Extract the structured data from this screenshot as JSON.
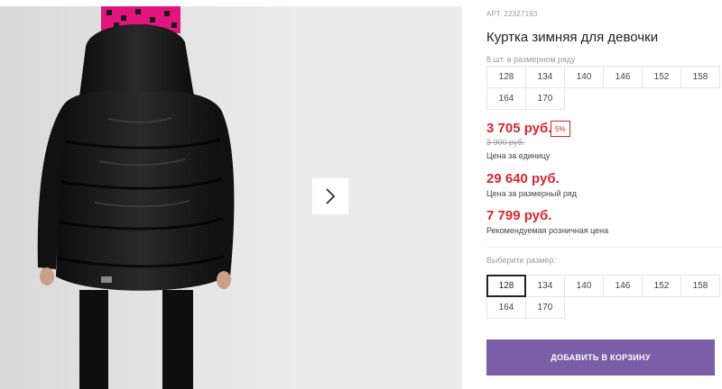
{
  "product": {
    "sku_label": "АРТ.",
    "sku": "22327193",
    "title": "Куртка зимняя для девочки"
  },
  "pack": {
    "label": "8 шт. в размерном ряду",
    "sizes": [
      "128",
      "134",
      "140",
      "146",
      "152",
      "158",
      "164",
      "170"
    ]
  },
  "prices": {
    "unit_price": "3 705 руб.",
    "discount": "5%",
    "old_price": "3 900 руб.",
    "unit_caption": "Цена за единицу",
    "pack_price": "29 640 руб.",
    "pack_caption": "Цена за размерный ряд",
    "rrp_price": "7 799 руб.",
    "rrp_caption": "Рекомендуемая розничная цена"
  },
  "size_select": {
    "label": "Выберите размер:",
    "sizes": [
      "128",
      "134",
      "140",
      "146",
      "152",
      "158",
      "164",
      "170"
    ],
    "selected": "128"
  },
  "actions": {
    "add_to_cart": "ДОБАВИТЬ В КОРЗИНУ"
  },
  "gallery": {
    "next_icon": "chevron-right-icon"
  },
  "colors": {
    "price_red": "#d8262e",
    "button_purple": "#7b5ea7",
    "photo_bg": "#e3e3e4",
    "jacket": "#141414",
    "hat_pink": "#e2157e"
  }
}
